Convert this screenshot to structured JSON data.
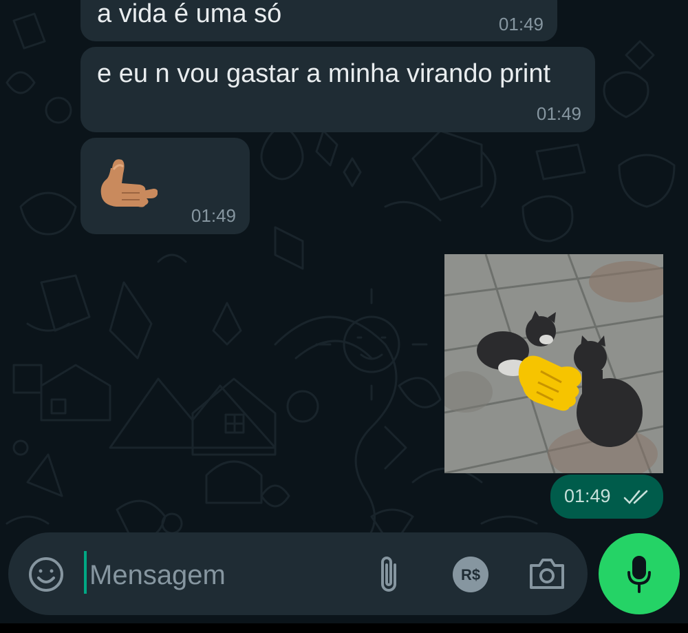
{
  "theme": {
    "background": "#0b141a",
    "incoming_bubble": "#1f2c34",
    "outgoing_bubble": "#005c4b",
    "accent": "#25d366",
    "caret": "#00a884"
  },
  "messages": [
    {
      "direction": "incoming",
      "text": "a vida é uma só",
      "time": "01:49"
    },
    {
      "direction": "incoming",
      "text": "e eu n vou gastar a minha virando print",
      "time": "01:49"
    },
    {
      "direction": "incoming",
      "emoji": "call-me-hand",
      "time": "01:49"
    },
    {
      "direction": "outgoing",
      "media": "image",
      "time": "01:49",
      "status": "read"
    }
  ],
  "composer": {
    "placeholder": "Mensagem",
    "value": "",
    "payment_label": "R$",
    "icons": [
      "emoji-icon",
      "attach-icon",
      "payment-icon",
      "camera-icon",
      "mic-icon"
    ]
  }
}
